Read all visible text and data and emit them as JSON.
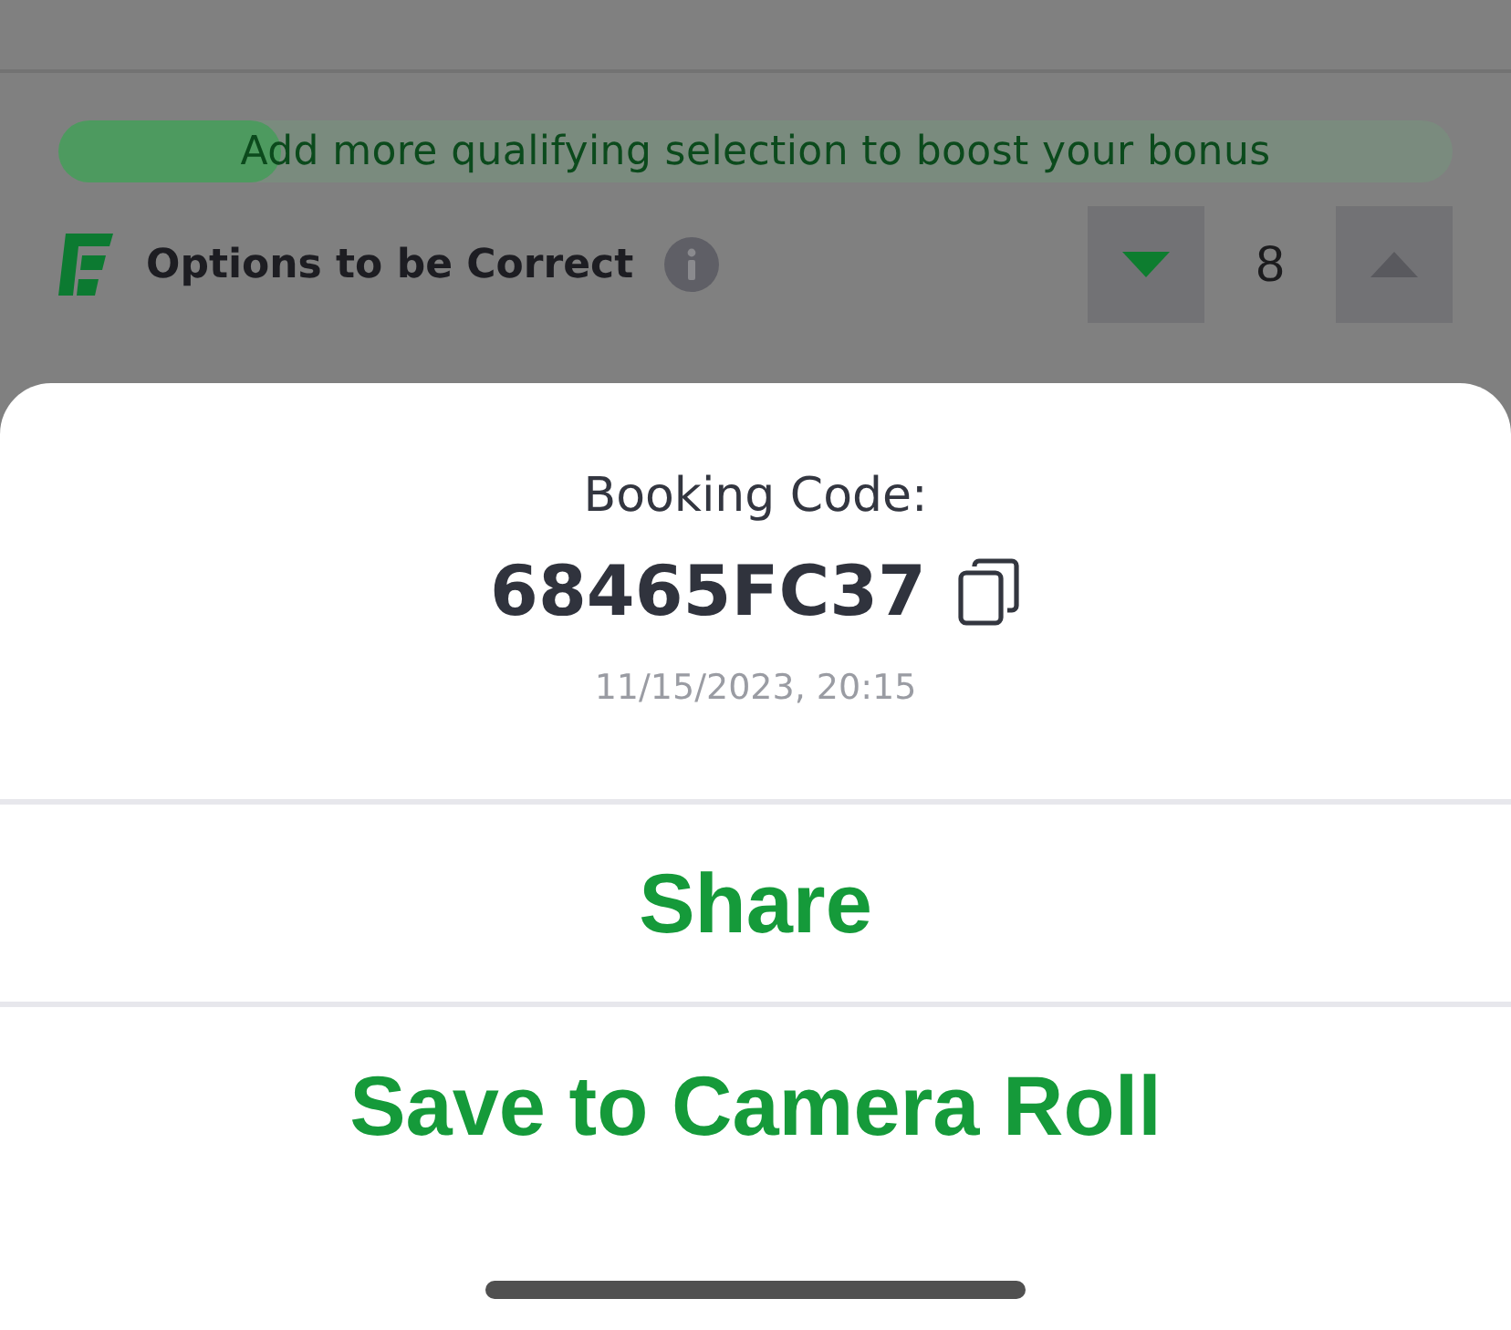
{
  "bonus_progress": {
    "message": "Add more qualifying selection to boost your bonus",
    "level": 0.16
  },
  "options": {
    "title": "Options to be Correct",
    "stepper": {
      "value": "8",
      "decrease": {
        "disabled": false
      },
      "increase": {
        "disabled": true
      }
    }
  },
  "booking_sheet": {
    "label": "Booking Code:",
    "code": "68465FC37",
    "timestamp": "11/15/2023, 20:15",
    "actions": [
      {
        "label": "Share"
      },
      {
        "label": "Save to Camera Roll"
      }
    ]
  }
}
